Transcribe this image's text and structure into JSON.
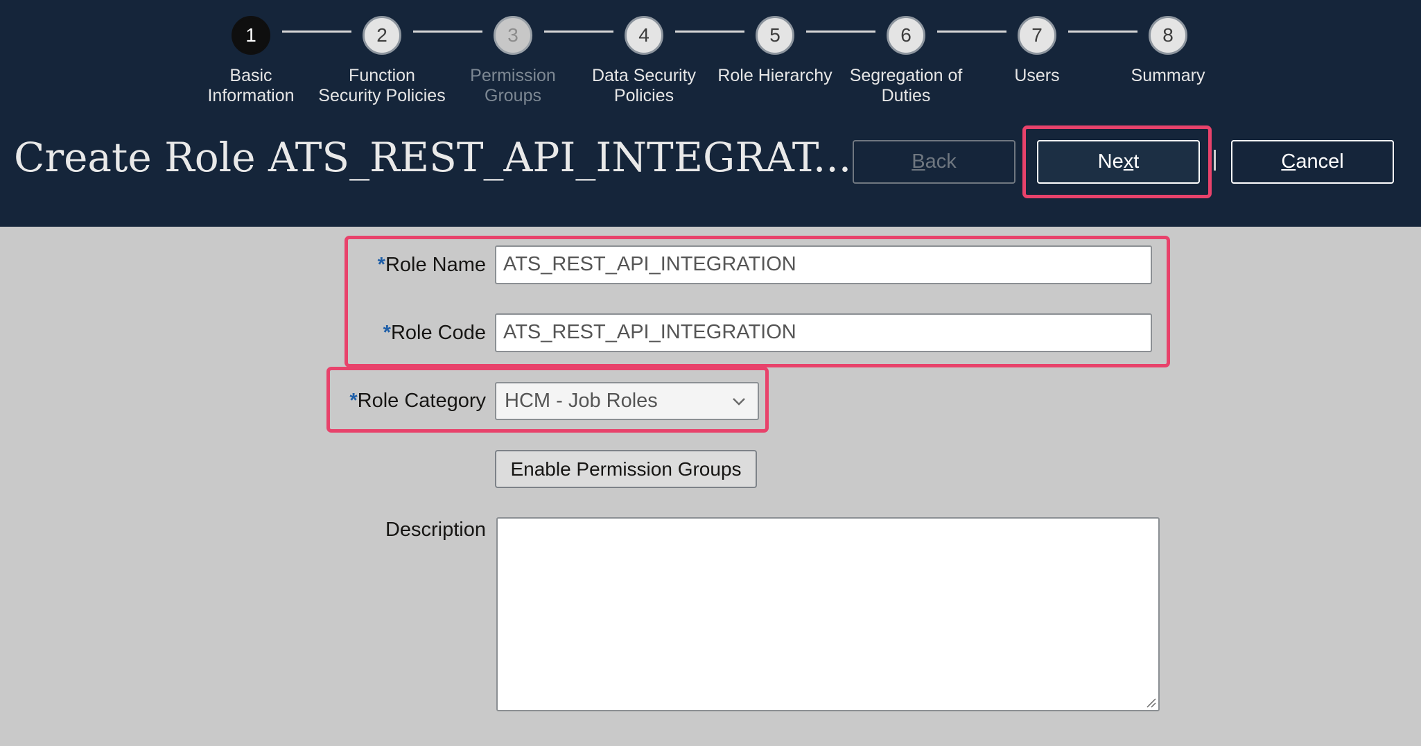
{
  "train": {
    "steps": [
      {
        "number": "1",
        "label_line1": "Basic",
        "label_line2": "Information",
        "state": "current"
      },
      {
        "number": "2",
        "label_line1": "Function",
        "label_line2": "Security Policies",
        "state": "normal"
      },
      {
        "number": "3",
        "label_line1": "Permission",
        "label_line2": "Groups",
        "state": "disabled"
      },
      {
        "number": "4",
        "label_line1": "Data Security",
        "label_line2": "Policies",
        "state": "normal"
      },
      {
        "number": "5",
        "label_line1": "Role Hierarchy",
        "label_line2": "",
        "state": "normal"
      },
      {
        "number": "6",
        "label_line1": "Segregation of",
        "label_line2": "Duties",
        "state": "normal"
      },
      {
        "number": "7",
        "label_line1": "Users",
        "label_line2": "",
        "state": "normal"
      },
      {
        "number": "8",
        "label_line1": "Summary",
        "label_line2": "",
        "state": "normal"
      }
    ]
  },
  "header": {
    "title": "Create Role ATS_REST_API_INTEGRAT...",
    "back": {
      "before": "",
      "accel": "B",
      "after": "ack"
    },
    "next": {
      "before": "Ne",
      "accel": "x",
      "after": "t"
    },
    "cancel": {
      "before": "",
      "accel": "C",
      "after": "ancel"
    }
  },
  "form": {
    "required_mark": "*",
    "role_name_label": "Role Name",
    "role_name_value": "ATS_REST_API_INTEGRATION",
    "role_code_label": "Role Code",
    "role_code_value": "ATS_REST_API_INTEGRATION",
    "role_category_label": "Role Category",
    "role_category_value": "HCM - Job Roles",
    "enable_permission_groups": "Enable Permission Groups",
    "description_label": "Description",
    "description_value": ""
  },
  "colors": {
    "header_bg": "#15253a",
    "page_bg": "#c9c9c9",
    "highlight": "#e8426b",
    "required": "#1f5fa8"
  }
}
